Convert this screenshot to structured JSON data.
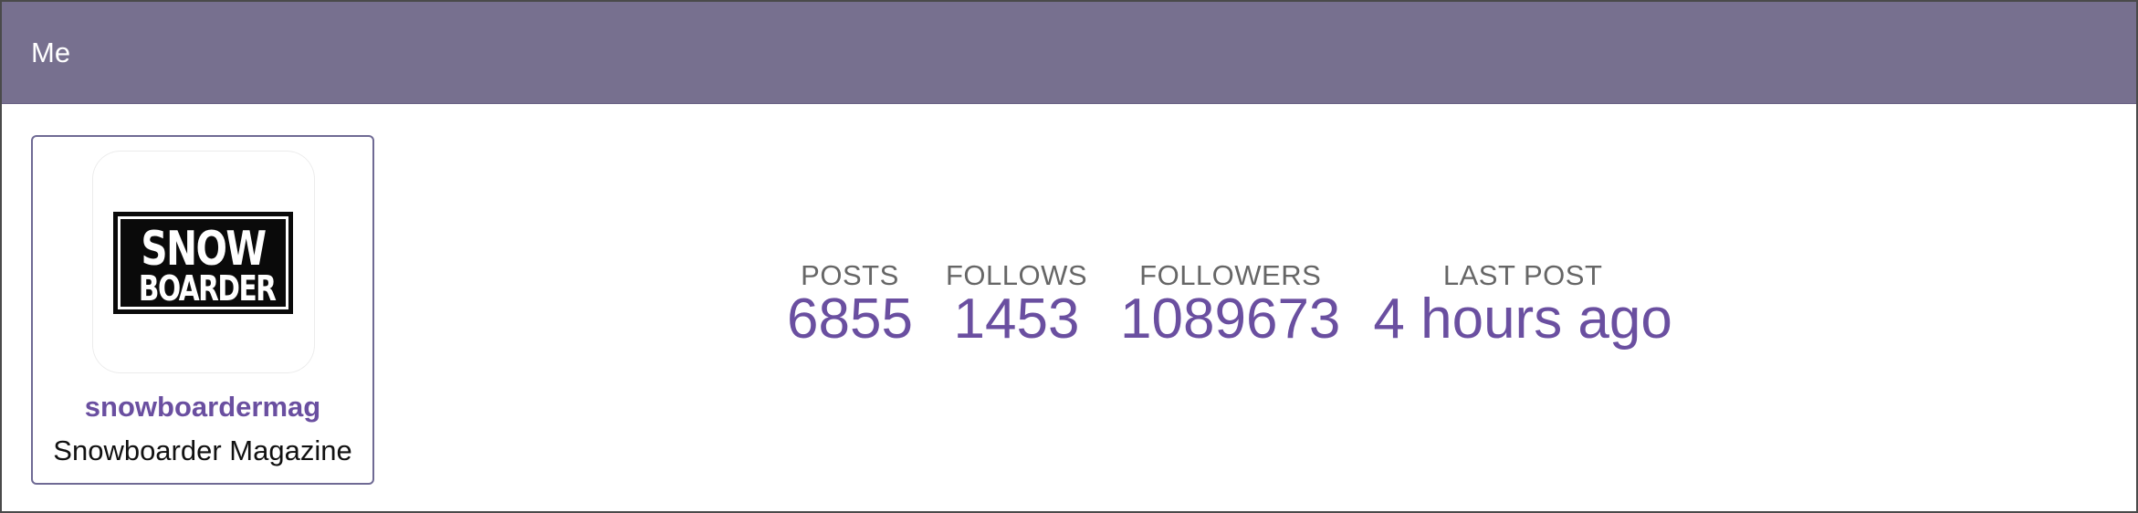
{
  "panel": {
    "title": "Me"
  },
  "profile": {
    "avatar": {
      "logo_text_line1": "SNOW",
      "logo_text_line2": "BOARDER"
    },
    "username": "snowboardermag",
    "full_name": "Snowboarder Magazine"
  },
  "stats": [
    {
      "label": "POSTS",
      "value": "6855"
    },
    {
      "label": "FOLLOWS",
      "value": "1453"
    },
    {
      "label": "FOLLOWERS",
      "value": "1089673"
    },
    {
      "label": "LAST POST",
      "value": "4 hours ago"
    }
  ],
  "colors": {
    "header_bg": "#77708f",
    "accent": "#6a4fa0",
    "label": "#666666"
  }
}
